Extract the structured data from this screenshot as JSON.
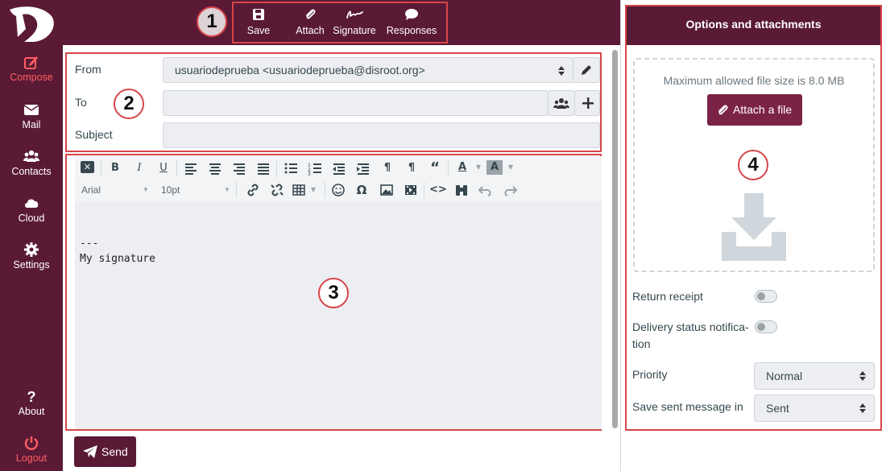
{
  "nav": {
    "items": [
      {
        "label": "Compose",
        "icon": "compose-icon"
      },
      {
        "label": "Mail",
        "icon": "envelope-icon"
      },
      {
        "label": "Contacts",
        "icon": "users-icon"
      },
      {
        "label": "Cloud",
        "icon": "cloud-icon"
      },
      {
        "label": "Settings",
        "icon": "gear-icon"
      },
      {
        "label": "About",
        "icon": "question-icon"
      },
      {
        "label": "Logout",
        "icon": "power-icon"
      }
    ],
    "active_color": "#ff5d62"
  },
  "toolbar": {
    "save_label": "Save",
    "attach_label": "Attach",
    "signature_label": "Signature",
    "responses_label": "Responses"
  },
  "callouts": {
    "one": "1",
    "two": "2",
    "three": "3",
    "four": "4"
  },
  "headers": {
    "from_label": "From",
    "from_value": "usuariodeprueba <usuariodeprueba@disroot.org>",
    "to_label": "To",
    "to_value": "",
    "subject_label": "Subject",
    "subject_value": ""
  },
  "editor": {
    "font_family": "Arial",
    "font_size": "10pt",
    "body_text": "---\nMy signature"
  },
  "send_label": "Send",
  "options": {
    "title": "Options and attachments",
    "max_size": "Maximum allowed file size is 8.0 MB",
    "attach_file_label": "Attach a file",
    "return_receipt_label": "Return receipt",
    "delivery_status_label_1": "Delivery status notifica-",
    "delivery_status_label_2": "tion",
    "priority_label": "Priority",
    "priority_value": "Normal",
    "save_sent_label": "Save sent message in",
    "save_sent_value": "Sent"
  },
  "colors": {
    "brand": "#5a1a35",
    "accent": "#7b2347",
    "highlight": "#d74549"
  }
}
